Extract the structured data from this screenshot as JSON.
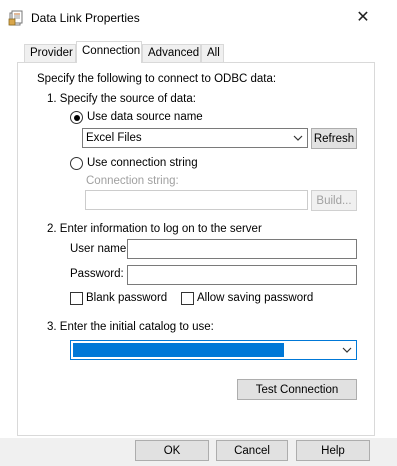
{
  "window": {
    "title": "Data Link Properties",
    "close_symbol": "✕"
  },
  "tabs": [
    {
      "label": "Provider"
    },
    {
      "label": "Connection"
    },
    {
      "label": "Advanced"
    },
    {
      "label": "All"
    }
  ],
  "connection": {
    "intro": "Specify the following to connect to ODBC data:",
    "step1": "1. Specify the source of data:",
    "use_dsn_label": "Use data source name",
    "dsn_value": "Excel Files",
    "refresh_label": "Refresh",
    "use_conn_string_label": "Use connection string",
    "conn_string_caption": "Connection string:",
    "build_label": "Build...",
    "step2": "2. Enter information to log on to the server",
    "username_label": "User name:",
    "password_label": "Password:",
    "blank_password_label": "Blank password",
    "allow_saving_label": "Allow saving password",
    "step3": "3. Enter the initial catalog to use:",
    "test_connection_label": "Test Connection"
  },
  "footer": {
    "ok_label": "OK",
    "cancel_label": "Cancel",
    "help_label": "Help"
  }
}
